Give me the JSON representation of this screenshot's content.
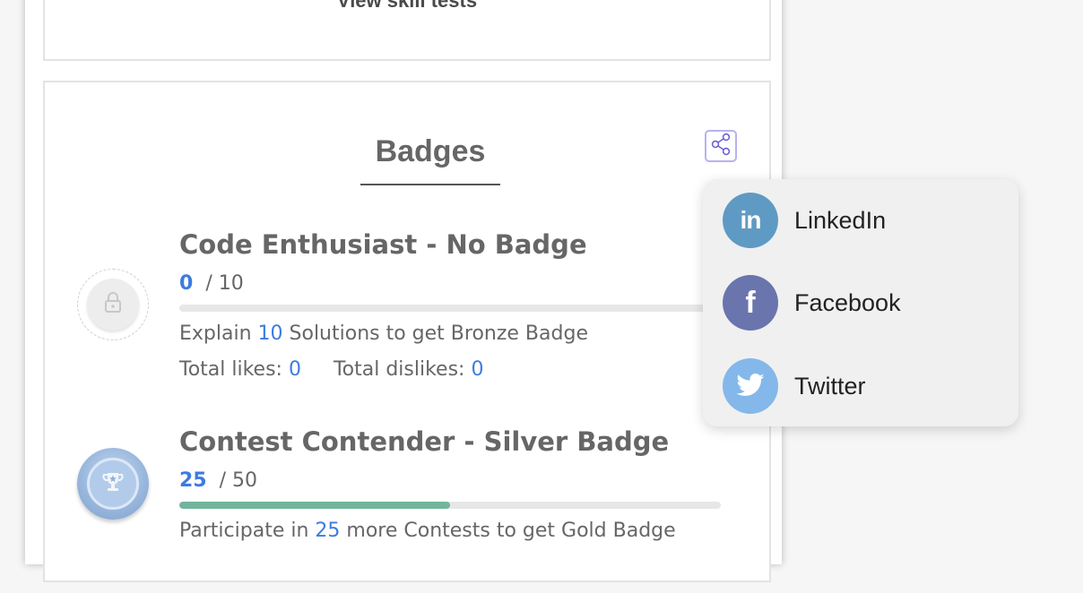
{
  "skill_tests": {
    "link_label": "View skill tests"
  },
  "badges_section": {
    "title": "Badges",
    "share_icon": "share-icon",
    "badges": [
      {
        "title": "Code Enthusiast - No Badge",
        "icon": "lock-icon",
        "current": "0",
        "total": "/ 10",
        "progress": 0,
        "desc_prefix": "Explain ",
        "desc_num": "10",
        "desc_suffix": " Solutions to get Bronze Badge",
        "likes_label": "Total likes: ",
        "likes": "0",
        "dislikes_label": "Total dislikes: ",
        "dislikes": "0"
      },
      {
        "title": "Contest Contender - Silver Badge",
        "icon": "trophy-icon",
        "current": "25",
        "total": "/ 50",
        "progress": 0.5,
        "desc_prefix": "Participate in ",
        "desc_num": "25",
        "desc_suffix": " more Contests to get Gold Badge"
      }
    ]
  },
  "share_menu": {
    "items": [
      {
        "label": "LinkedIn",
        "icon": "linkedin-icon",
        "color": "#5f9ac4"
      },
      {
        "label": "Facebook",
        "icon": "facebook-icon",
        "color": "#6a75ad"
      },
      {
        "label": "Twitter",
        "icon": "twitter-icon",
        "color": "#84b8ea"
      }
    ]
  },
  "colors": {
    "link_blue": "#3d7be0",
    "progress_fill": "#72b59c",
    "share_border": "#b6b2f0"
  }
}
